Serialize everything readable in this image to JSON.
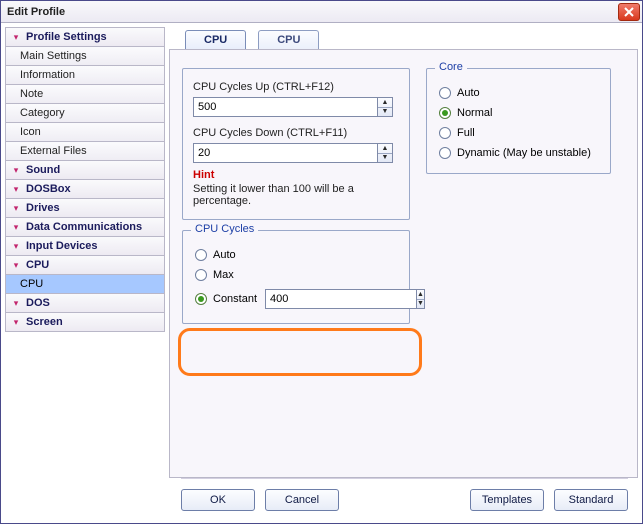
{
  "window": {
    "title": "Edit Profile"
  },
  "sidebar": {
    "profile_settings": {
      "label": "Profile Settings",
      "items": [
        {
          "label": "Main Settings"
        },
        {
          "label": "Information"
        },
        {
          "label": "Note"
        },
        {
          "label": "Category"
        },
        {
          "label": "Icon"
        },
        {
          "label": "External Files"
        }
      ]
    },
    "collapsed": [
      {
        "label": "Sound"
      },
      {
        "label": "DOSBox"
      },
      {
        "label": "Drives"
      },
      {
        "label": "Data Communications"
      },
      {
        "label": "Input Devices"
      }
    ],
    "cpu": {
      "label": "CPU",
      "items": [
        {
          "label": "CPU",
          "selected": true
        }
      ]
    },
    "collapsed2": [
      {
        "label": "DOS"
      },
      {
        "label": "Screen"
      }
    ]
  },
  "tabs": [
    {
      "label": "CPU",
      "active": true
    },
    {
      "label": "CPU",
      "active": false
    }
  ],
  "cpu_panel": {
    "cycles_up_label": "CPU Cycles Up (CTRL+F12)",
    "cycles_up_value": "500",
    "cycles_down_label": "CPU Cycles Down (CTRL+F11)",
    "cycles_down_value": "20",
    "hint_title": "Hint",
    "hint_text": "Setting it lower than 100 will be a percentage."
  },
  "cpu_cycles": {
    "legend": "CPU Cycles",
    "auto": "Auto",
    "max": "Max",
    "constant": "Constant",
    "constant_value": "400",
    "selected": "constant"
  },
  "core": {
    "legend": "Core",
    "options": {
      "auto": "Auto",
      "normal": "Normal",
      "full": "Full",
      "dynamic": "Dynamic (May be unstable)"
    },
    "selected": "normal"
  },
  "footer": {
    "ok": "OK",
    "cancel": "Cancel",
    "templates": "Templates",
    "standard": "Standard"
  }
}
